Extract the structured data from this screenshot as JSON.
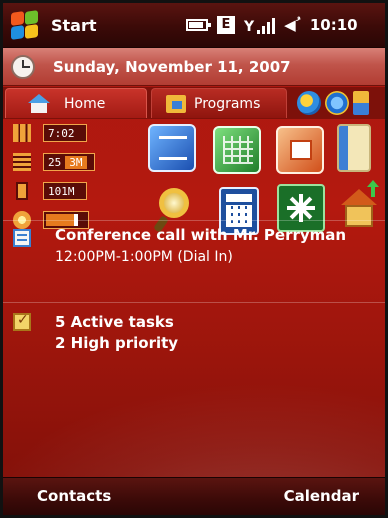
{
  "status_bar": {
    "start_label": "Start",
    "clock": "10:10",
    "network_badge": "E",
    "icons": [
      "battery-icon",
      "edge-network-icon",
      "signal-icon",
      "speaker-icon"
    ]
  },
  "date_row": {
    "date": "Sunday, November 11, 2007"
  },
  "tabs": {
    "home_label": "Home",
    "programs_label": "Programs",
    "quick_launch_icons": [
      "media-player-icon",
      "internet-explorer-icon",
      "more-programs-icon"
    ]
  },
  "gauges": {
    "time_value": "7:02",
    "battery_percent": "25",
    "battery_hours": "3M",
    "memory_value": "101M",
    "brightness_level": 0.3
  },
  "apps": {
    "row1": [
      "word-icon",
      "excel-icon",
      "powerpoint-icon",
      "notes-icon"
    ],
    "row2": [
      "search-icon",
      "calculator-icon",
      "connection-icon",
      "home-update-icon"
    ]
  },
  "appointment": {
    "title": "Conference call with Mr. Perryman",
    "time": "12:00PM-1:00PM (Dial In)"
  },
  "tasks": {
    "active": "5 Active tasks",
    "priority": "2 High priority"
  },
  "softkeys": {
    "left": "Contacts",
    "right": "Calendar"
  },
  "colors": {
    "background": "#a81810",
    "status_bar": "#3b0a08",
    "accent_orange": "#e67a1e"
  }
}
